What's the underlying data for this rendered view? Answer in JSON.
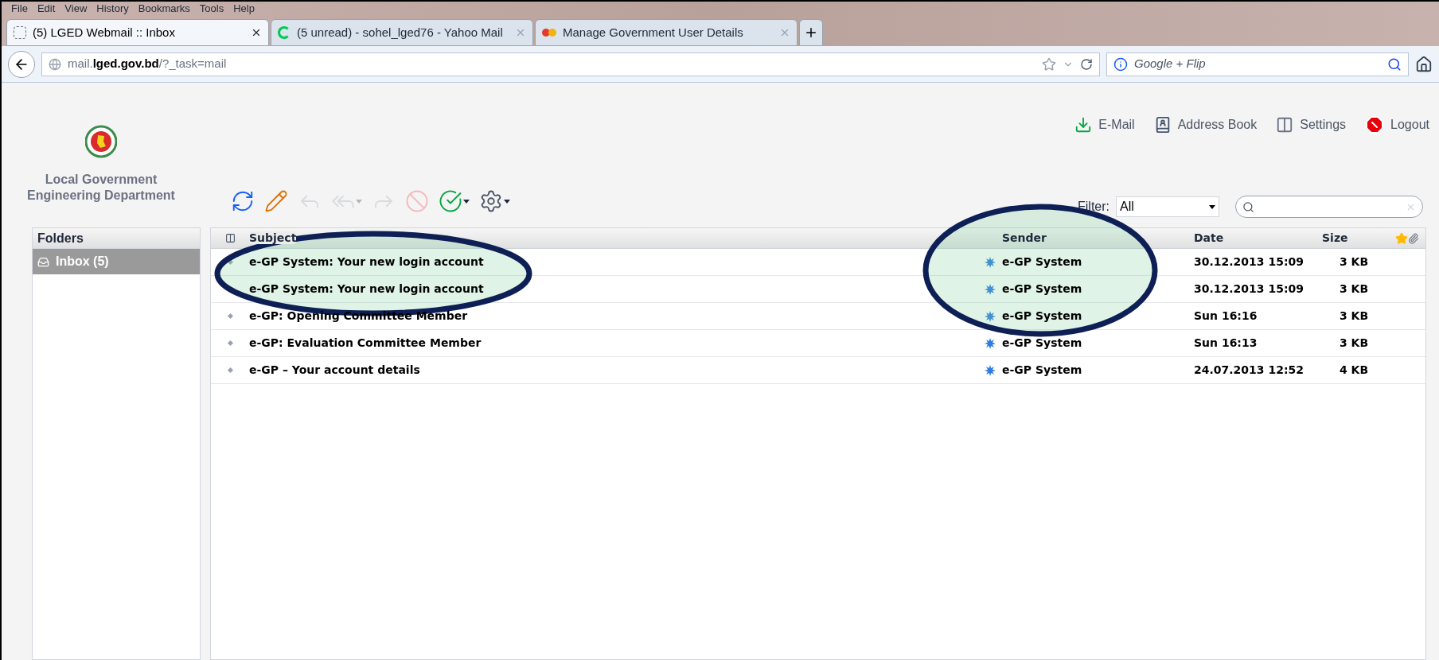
{
  "menu": [
    "File",
    "Edit",
    "View",
    "History",
    "Bookmarks",
    "Tools",
    "Help"
  ],
  "tabs": [
    {
      "label": "(5) LGED Webmail :: Inbox",
      "selected": true,
      "kind": "page"
    },
    {
      "label": "(5 unread) - sohel_lged76 - Yahoo Mail",
      "selected": false,
      "kind": "loading"
    },
    {
      "label": "Manage Government User Details",
      "selected": false,
      "kind": "site"
    }
  ],
  "address_bar": {
    "url": "mail.**lged.gov.bd**/?_task=mail"
  },
  "search_bar": {
    "placeholder": "Google + Flip"
  },
  "logo_text": [
    "Local Government",
    "Engineering Department"
  ],
  "header_links": [
    {
      "label": "E-Mail",
      "kind": "mail"
    },
    {
      "label": "Address Book",
      "kind": "contacts"
    },
    {
      "label": "Settings",
      "kind": "settings"
    },
    {
      "label": "Logout",
      "kind": "logout"
    }
  ],
  "toolbar": [
    {
      "kind": "refresh",
      "disabled": false
    },
    {
      "kind": "compose",
      "disabled": false
    },
    {
      "kind": "reply",
      "disabled": true
    },
    {
      "kind": "reply_all",
      "disabled": true
    },
    {
      "kind": "forward",
      "disabled": true
    },
    {
      "kind": "delete",
      "disabled": true
    },
    {
      "kind": "mark",
      "disabled": false
    },
    {
      "kind": "more",
      "disabled": false
    }
  ],
  "filter": {
    "label": "Filter:",
    "value": "All"
  },
  "folders": {
    "title": "Folders",
    "items": [
      {
        "label": "Inbox (5)",
        "selected": true
      }
    ]
  },
  "table": {
    "columns": [
      "Subject",
      "Sender",
      "Date",
      "Size"
    ],
    "rows": [
      {
        "subject": "e-GP System: Your new login account",
        "sender": "e-GP System",
        "date": "30.12.2013 15:09",
        "size": "3 KB"
      },
      {
        "subject": "e-GP System: Your new login account",
        "sender": "e-GP System",
        "date": "30.12.2013 15:09",
        "size": "3 KB"
      },
      {
        "subject": "e-GP: Opening Committee Member",
        "sender": "e-GP System",
        "date": "Sun 16:16",
        "size": "3 KB"
      },
      {
        "subject": "e-GP: Evaluation Committee Member",
        "sender": "e-GP System",
        "date": "Sun 16:13",
        "size": "3 KB"
      },
      {
        "subject": "e-GP – Your account details",
        "sender": "e-GP System",
        "date": "24.07.2013 12:52",
        "size": "4 KB"
      }
    ]
  }
}
